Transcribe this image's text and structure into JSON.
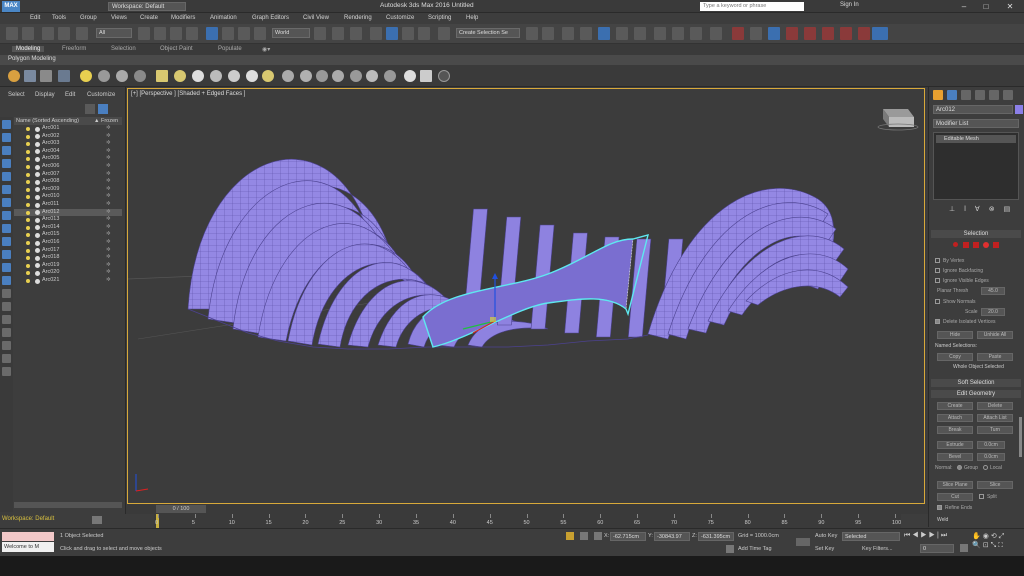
{
  "titlebar": {
    "logo": "MAX",
    "workspace": "Workspace: Default",
    "title": "Autodesk 3ds Max 2016    Untitled",
    "search_placeholder": "Type a keyword or phrase",
    "signin": "Sign In"
  },
  "menu": [
    "Edit",
    "Tools",
    "Group",
    "Views",
    "Create",
    "Modifiers",
    "Animation",
    "Graph Editors",
    "Civil View",
    "Rendering",
    "Customize",
    "Scripting",
    "Help"
  ],
  "toolbar": {
    "filter": "All",
    "coord": "World",
    "selset": "Create Selection Se"
  },
  "ribbon": {
    "tabs": [
      "Modeling",
      "Freeform",
      "Selection",
      "Object Paint",
      "Populate"
    ],
    "sub": "Polygon Modeling"
  },
  "scene": {
    "menu": [
      "Select",
      "Display",
      "Edit",
      "Customize"
    ],
    "col_name": "Name (Sorted Ascending)",
    "col_frozen": "▲ Frozen",
    "items": [
      "Arc001",
      "Arc002",
      "Arc003",
      "Arc004",
      "Arc005",
      "Arc006",
      "Arc007",
      "Arc008",
      "Arc009",
      "Arc010",
      "Arc011",
      "Arc012",
      "Arc013",
      "Arc014",
      "Arc015",
      "Arc016",
      "Arc017",
      "Arc018",
      "Arc019",
      "Arc020",
      "Arc021"
    ],
    "selected_index": 11
  },
  "viewport": {
    "label": "[+] [Perspective ] [Shaded + Edged Faces ]"
  },
  "command": {
    "object_name": "Arc012",
    "modifier_list": "Modifier List",
    "stack_item": "Editable Mesh",
    "selection_title": "Selection",
    "by_vertex": "By Vertex",
    "ignore_backfacing": "Ignore Backfacing",
    "ignore_visible_edges": "Ignore Visible Edges",
    "planar_thresh": "Planar Thresh",
    "planar_value": "45.0",
    "show_normals": "Show Normals",
    "scale": "Scale",
    "scale_value": "20.0",
    "delete_isolated": "Delete Isolated Vertices",
    "hide": "Hide",
    "unhide_all": "Unhide All",
    "named_selections": "Named Selections:",
    "copy": "Copy",
    "paste": "Paste",
    "whole_object": "Whole Object Selected",
    "soft_selection": "Soft Selection",
    "edit_geometry": "Edit Geometry",
    "create": "Create",
    "delete": "Delete",
    "attach": "Attach",
    "attach_list": "Attach List",
    "break": "Break",
    "turn": "Turn",
    "extrude": "Extrude",
    "extrude_value": "0.0cm",
    "bevel": "Bevel",
    "bevel_value": "0.0cm",
    "normal": "Normal:",
    "group": "Group",
    "local": "Local",
    "slice_plane": "Slice Plane",
    "slice": "Slice",
    "cut": "Cut",
    "split": "Split",
    "refine_ends": "Refine Ends",
    "weld": "Weld"
  },
  "timeline": {
    "slider": "0 / 100",
    "ticks": [
      "0",
      "5",
      "10",
      "15",
      "20",
      "25",
      "30",
      "35",
      "40",
      "45",
      "50",
      "55",
      "60",
      "65",
      "70",
      "75",
      "80",
      "85",
      "90",
      "95",
      "100"
    ]
  },
  "status": {
    "workspace": "Workspace: Default",
    "welcome": "Welcome to M",
    "objects": "1 Object Selected",
    "prompt": "Click and drag to select and move objects",
    "x": "-62.715cm",
    "y": "-30843.97",
    "z": "-631.395cm",
    "grid": "Grid = 1000.0cm",
    "add_time_tag": "Add Time Tag",
    "auto_key": "Auto Key",
    "selected": "Selected",
    "set_key": "Set Key",
    "key_filters": "Key Filters...",
    "frame": "0"
  }
}
